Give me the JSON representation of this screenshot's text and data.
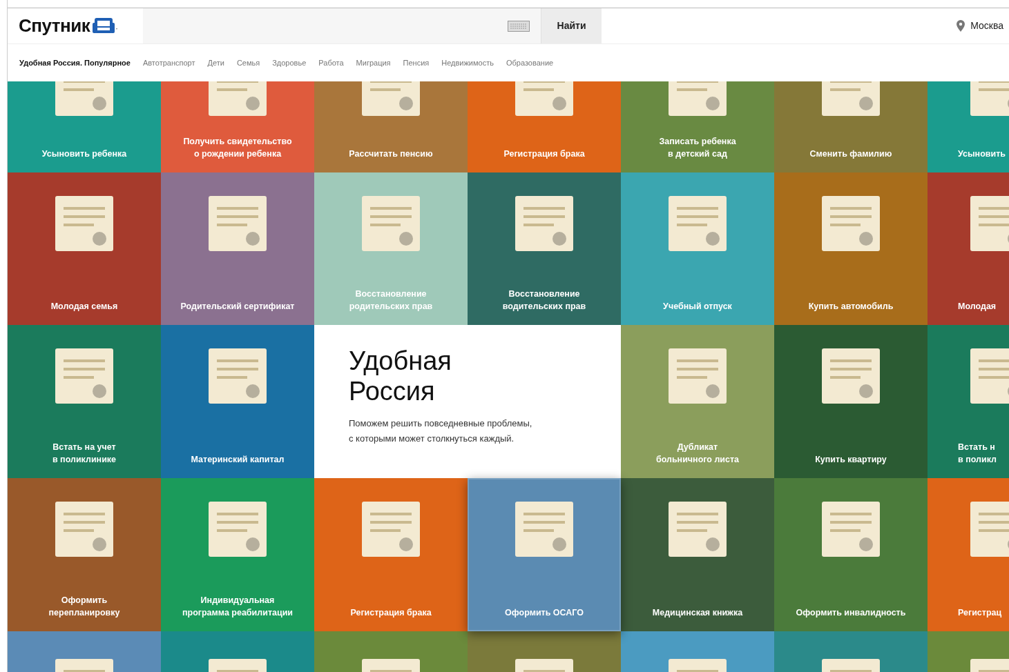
{
  "header": {
    "logo": "Спутник",
    "search": {
      "button": "Найти"
    },
    "location": "Москва"
  },
  "nav": [
    {
      "label": "Удобная Россия. Популярное",
      "selected": true
    },
    {
      "label": "Автотранспорт",
      "selected": false
    },
    {
      "label": "Дети",
      "selected": false
    },
    {
      "label": "Семья",
      "selected": false
    },
    {
      "label": "Здоровье",
      "selected": false
    },
    {
      "label": "Работа",
      "selected": false
    },
    {
      "label": "Миграция",
      "selected": false
    },
    {
      "label": "Пенсия",
      "selected": false
    },
    {
      "label": "Недвижимость",
      "selected": false
    },
    {
      "label": "Образование",
      "selected": false
    }
  ],
  "rows": [
    [
      {
        "kind": "tile",
        "label": "Усыновить ребенка",
        "color": "#1b9c8e",
        "raised": false
      },
      {
        "kind": "tile",
        "label": "Получить свидетельство\nо рождении ребенка",
        "color": "#df5b3d",
        "raised": false
      },
      {
        "kind": "tile",
        "label": "Рассчитать пенсию",
        "color": "#a9763b",
        "raised": false
      },
      {
        "kind": "tile",
        "label": "Регистрация брака",
        "color": "#de6418",
        "raised": false
      },
      {
        "kind": "tile",
        "label": "Записать ребенка\nв детский сад",
        "color": "#698a42",
        "raised": false
      },
      {
        "kind": "tile",
        "label": "Сменить фамилию",
        "color": "#857838",
        "raised": false
      },
      {
        "kind": "tile",
        "label": "Усыновить",
        "color": "#1b9c8e",
        "raised": false
      }
    ],
    [
      {
        "kind": "tile",
        "label": "Молодая семья",
        "color": "#a63b2c",
        "raised": false
      },
      {
        "kind": "tile",
        "label": "Родительский сертификат",
        "color": "#8b7190",
        "raised": false
      },
      {
        "kind": "tile",
        "label": "Восстановление\nродительских прав",
        "color": "#9fc9b9",
        "raised": false
      },
      {
        "kind": "tile",
        "label": "Восстановление\nводительских прав",
        "color": "#2f6b63",
        "raised": false
      },
      {
        "kind": "tile",
        "label": "Учебный отпуск",
        "color": "#3ba6b0",
        "raised": false
      },
      {
        "kind": "tile",
        "label": "Купить автомобиль",
        "color": "#a86d1b",
        "raised": false
      },
      {
        "kind": "tile",
        "label": "Молодая",
        "color": "#a63b2c",
        "raised": false
      }
    ],
    [
      {
        "kind": "tile",
        "label": "Встать на учет\nв поликлинике",
        "color": "#1b7b5c",
        "raised": false
      },
      {
        "kind": "tile",
        "label": "Материнский капитал",
        "color": "#1a70a3",
        "raised": false
      },
      {
        "kind": "intro",
        "title": "Удобная Россия",
        "text": "Поможем решить повседневные проблемы,\nс которыми может столкнуться каждый."
      },
      {
        "kind": "tile",
        "label": "Дубликат\nбольничного листа",
        "color": "#8b9e5c",
        "raised": false
      },
      {
        "kind": "tile",
        "label": "Купить квартиру",
        "color": "#2b5b33",
        "raised": false
      },
      {
        "kind": "tile",
        "label": "Встать н\nв поликл",
        "color": "#1b7b5c",
        "raised": false
      }
    ],
    [
      {
        "kind": "tile",
        "label": "Оформить\nперепланировку",
        "color": "#99592a",
        "raised": false
      },
      {
        "kind": "tile",
        "label": "Индивидуальная\nпрограмма реабилитации",
        "color": "#1b9b5b",
        "raised": false
      },
      {
        "kind": "tile",
        "label": "Регистрация брака",
        "color": "#de6418",
        "raised": false
      },
      {
        "kind": "tile",
        "label": "Оформить ОСАГО",
        "color": "#5b8bb2",
        "raised": true
      },
      {
        "kind": "tile",
        "label": "Медицинская книжка",
        "color": "#3c5c3c",
        "raised": false
      },
      {
        "kind": "tile",
        "label": "Оформить инвалидность",
        "color": "#4b7b3b",
        "raised": false
      },
      {
        "kind": "tile",
        "label": "Регистрац",
        "color": "#de6418",
        "raised": false
      }
    ],
    [
      {
        "kind": "tile",
        "color": "#5b8bb6",
        "raised": false
      },
      {
        "kind": "tile",
        "color": "#1b8a8a",
        "raised": false
      },
      {
        "kind": "tile",
        "color": "#6b8a3b",
        "raised": false
      },
      {
        "kind": "tile",
        "color": "#7b7a3b",
        "raised": false
      },
      {
        "kind": "tile",
        "color": "#4b9bc1",
        "raised": false
      },
      {
        "kind": "tile",
        "color": "#2b8a8a",
        "raised": false
      },
      {
        "kind": "tile",
        "color": "#6b8a3b",
        "raised": false
      }
    ]
  ]
}
